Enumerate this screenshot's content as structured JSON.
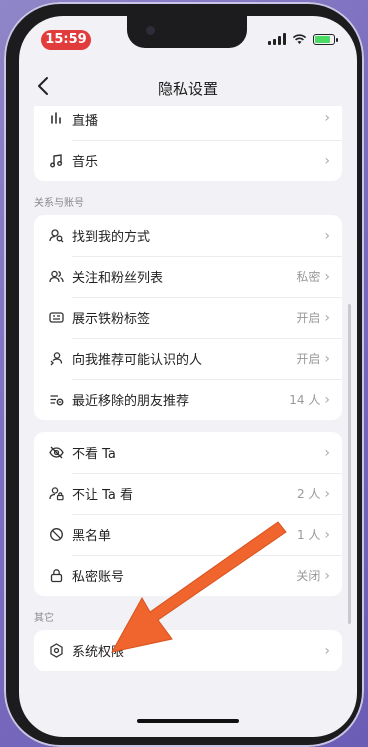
{
  "status": {
    "time": "15:59"
  },
  "nav": {
    "title": "隐私设置"
  },
  "top_rows": [
    {
      "label": "直播",
      "icon": "live-bars-icon"
    },
    {
      "label": "音乐",
      "icon": "music-note-icon"
    }
  ],
  "sections": {
    "relations": "关系与账号",
    "other": "其它"
  },
  "relation_rows": [
    {
      "label": "找到我的方式",
      "value": "",
      "icon": "person-search-icon"
    },
    {
      "label": "关注和粉丝列表",
      "value": "私密",
      "icon": "people-icon"
    },
    {
      "label": "展示铁粉标签",
      "value": "开启",
      "icon": "badge-icon"
    },
    {
      "label": "向我推荐可能认识的人",
      "value": "开启",
      "icon": "suggest-person-icon"
    },
    {
      "label": "最近移除的朋友推荐",
      "value": "14 人",
      "icon": "list-remove-icon"
    }
  ],
  "privacy_rows": [
    {
      "label": "不看 Ta",
      "value": "",
      "icon": "eye-off-icon"
    },
    {
      "label": "不让 Ta 看",
      "value": "2 人",
      "icon": "person-lock-icon"
    },
    {
      "label": "黑名单",
      "value": "1 人",
      "icon": "block-icon"
    },
    {
      "label": "私密账号",
      "value": "关闭",
      "icon": "lock-icon"
    }
  ],
  "other_rows": [
    {
      "label": "系统权限",
      "value": "",
      "icon": "hexagon-settings-icon"
    }
  ],
  "colors": {
    "time_pill": "#e23b3b",
    "annotation_arrow": "#f0642d",
    "battery": "#4cd964"
  }
}
